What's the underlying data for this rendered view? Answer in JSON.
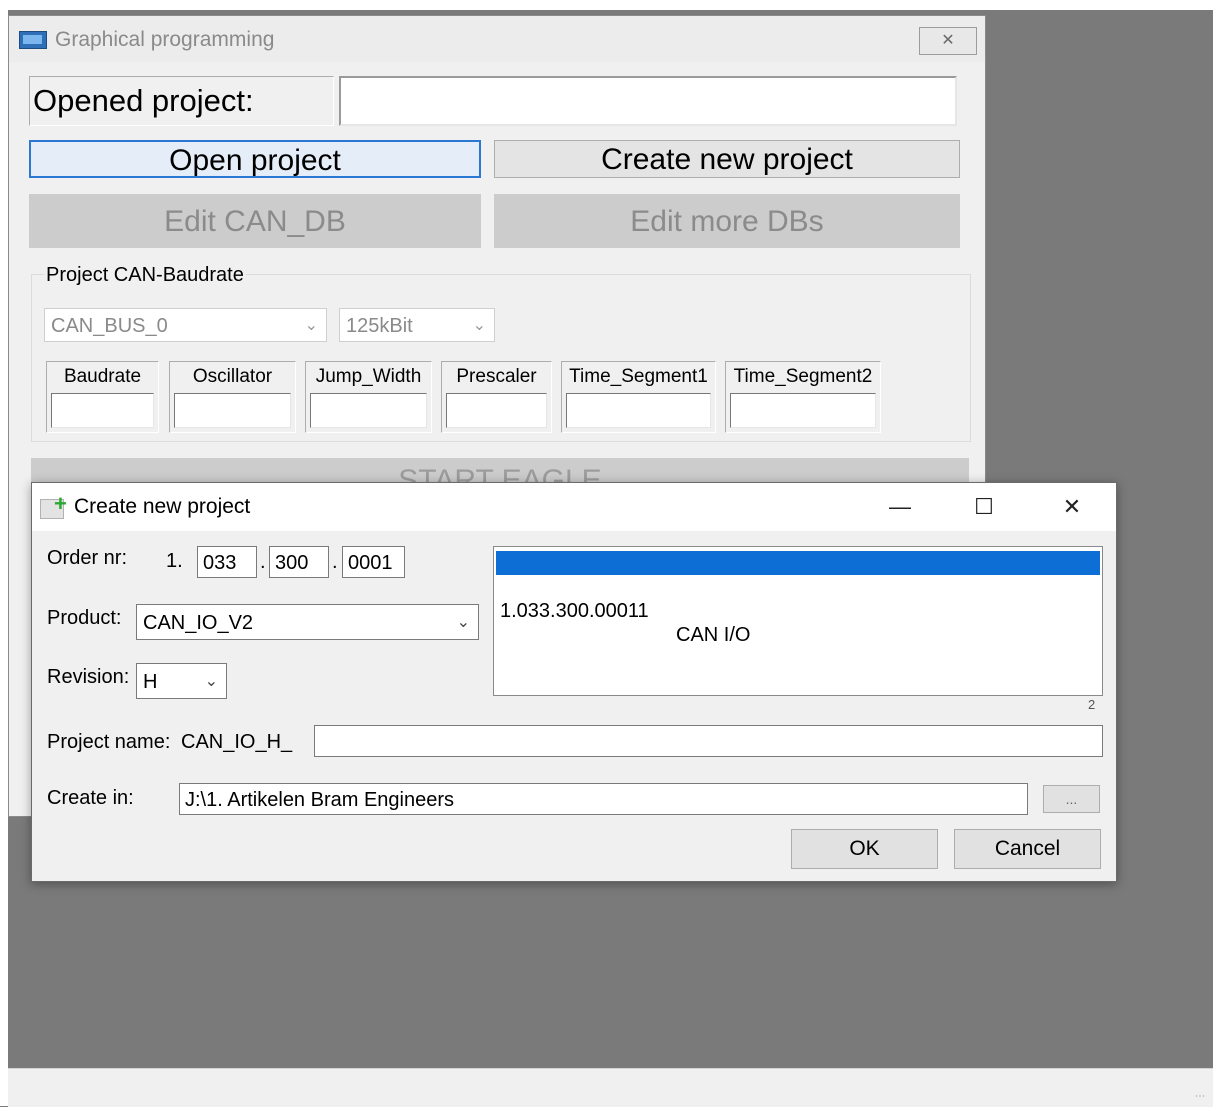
{
  "main_window": {
    "title": "Graphical programming",
    "close_glyph": "✕",
    "opened_project_label": "Opened project:",
    "opened_project_value": "",
    "open_project_button": "Open project",
    "create_new_project_button": "Create new project",
    "edit_can_db_button": "Edit CAN_DB",
    "edit_more_dbs_button": "Edit more DBs",
    "baudrate_group_label": "Project CAN-Baudrate",
    "bus_combo_value": "CAN_BUS_0",
    "speed_combo_value": "125kBit",
    "params": [
      {
        "label": "Baudrate",
        "value": ""
      },
      {
        "label": "Oscillator",
        "value": ""
      },
      {
        "label": "Jump_Width",
        "value": ""
      },
      {
        "label": "Prescaler",
        "value": ""
      },
      {
        "label": "Time_Segment1",
        "value": ""
      },
      {
        "label": "Time_Segment2",
        "value": ""
      }
    ],
    "start_button": "START EAGLE"
  },
  "dialog": {
    "title": "Create new project",
    "minimize_glyph": "—",
    "maximize_glyph": "☐",
    "close_glyph": "✕",
    "order_nr_label": "Order nr:",
    "order_prefix": "1.",
    "order_part1": "033",
    "order_sep1": ".",
    "order_part2": "300",
    "order_sep2": ".",
    "order_part3": "0001",
    "product_label": "Product:",
    "product_value": "CAN_IO_V2",
    "revision_label": "Revision:",
    "revision_value": "H",
    "list_items": [
      {
        "order": "1.033.300.0001",
        "name": "CAN I/O"
      },
      {
        "order": "1.033.300.00011",
        "name": "CAN I/O"
      }
    ],
    "list_count": "2",
    "project_name_label": "Project name:",
    "project_name_prefix": "CAN_IO_H_",
    "project_name_value": "",
    "create_in_label": "Create in:",
    "create_in_value": "J:\\1. Artikelen Bram Engineers",
    "browse_button": "...",
    "ok_button": "OK",
    "cancel_button": "Cancel"
  },
  "icons": {
    "app": "app-window-icon",
    "dialog": "new-document-plus-icon",
    "dropdown": "chevron-down-icon"
  }
}
